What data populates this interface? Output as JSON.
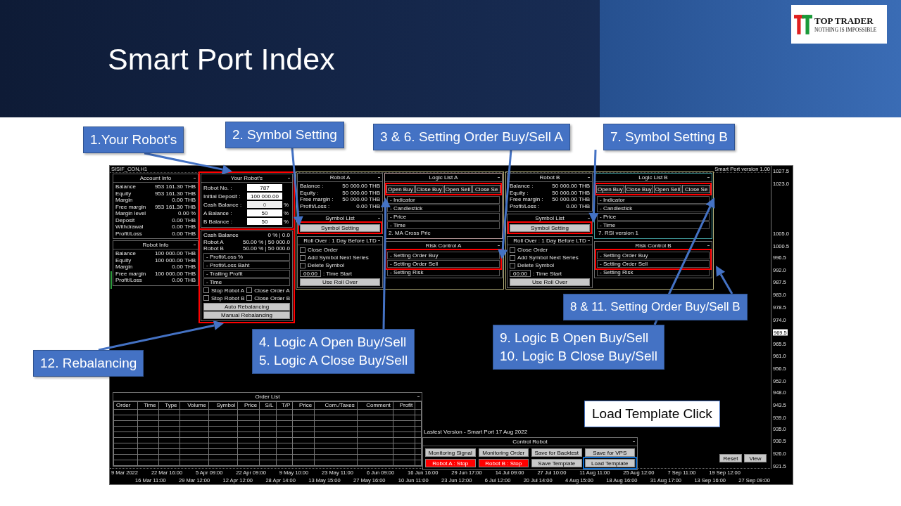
{
  "slide": {
    "title": "Smart Port Index",
    "logo": {
      "name": "TOP TRADER",
      "tagline": "NOTHING IS IMPOSSIBLE"
    }
  },
  "terminal": {
    "chart_title": "SISIF_CON,H1",
    "version": "Smart Port version 1.00",
    "account_info": {
      "title": "Account Info",
      "rows": [
        {
          "label": "Balance",
          "value": "953 161.30 THB"
        },
        {
          "label": "Equity",
          "value": "953 161.30 THB"
        },
        {
          "label": "Margin",
          "value": "0.00 THB"
        },
        {
          "label": "Free margin",
          "value": "953 161.30 THB"
        },
        {
          "label": "Margin level",
          "value": "0.00 %"
        },
        {
          "label": "Deposit",
          "value": "0.00 THB"
        },
        {
          "label": "Withdrawal",
          "value": "0.00 THB"
        },
        {
          "label": "Profit/Loss",
          "value": "0.00 THB"
        }
      ]
    },
    "robot_info": {
      "title": "Robot Info",
      "rows": [
        {
          "label": "Balance",
          "value": "100 000.00 THB"
        },
        {
          "label": "Equity",
          "value": "100 000.00 THB"
        },
        {
          "label": "Margin",
          "value": "0.00 THB"
        },
        {
          "label": "Free margin",
          "value": "100 000.00 THB"
        },
        {
          "label": "Profit/Loss",
          "value": "0.00 THB"
        }
      ]
    },
    "your_robots": {
      "title": "Your Robot's",
      "fields": [
        {
          "label": "Robot No. :",
          "value": "787",
          "disabled": false
        },
        {
          "label": "Initial Deposit :",
          "value": "100 000.00",
          "disabled": false
        },
        {
          "label": "Cash Balance :",
          "value": "0",
          "unit": "%",
          "disabled": true
        },
        {
          "label": "A Balance :",
          "value": "50",
          "unit": "%",
          "disabled": false
        },
        {
          "label": "B Balance :",
          "value": "50",
          "unit": "%",
          "disabled": false
        }
      ]
    },
    "rebalancing": {
      "rows": [
        {
          "label": "Cash Balance",
          "value": "0 % | 0.0"
        },
        {
          "label": "Robot A",
          "value": "50.00 % | 50 000.0"
        },
        {
          "label": "Robot B",
          "value": "50.00 % | 50 000.0"
        }
      ],
      "sections": [
        "- Profit/Loss %",
        "- Profit/Loss Baht",
        "- Trailing Profit",
        "- Time"
      ],
      "checkboxes": [
        {
          "label": "Stop Robot A",
          "checked": false
        },
        {
          "label": "Close Order A",
          "checked": false
        },
        {
          "label": "Stop Robot B",
          "checked": false
        },
        {
          "label": "Close Order B",
          "checked": false
        }
      ],
      "buttons": [
        "Auto Rebalancing",
        "Manual Rebalancing"
      ]
    },
    "robots": [
      {
        "title": "Robot A",
        "color": "#b89a9a",
        "rows": [
          {
            "label": "Balance :",
            "value": "50 000.00 THB"
          },
          {
            "label": "Equity :",
            "value": "50 000.00 THB"
          },
          {
            "label": "Free margin :",
            "value": "50 000.00 THB"
          },
          {
            "label": "Profit/Loss :",
            "value": "0.00 THB"
          }
        ],
        "symbol_list": {
          "title": "Symbol List",
          "button": "Symbol Setting"
        },
        "roll_over": {
          "title": "Roll Over : 1 Day Before LTD",
          "checkboxes": [
            {
              "label": "Close Order",
              "checked": false
            },
            {
              "label": "Add Symbol Next Series",
              "checked": false
            },
            {
              "label": "Delete Symbol",
              "checked": false
            }
          ],
          "time": "00:00",
          "time_label": ": Time Start",
          "button": "Use Roll Over"
        },
        "logic_list": {
          "title": "Logic List A",
          "tabs": [
            "Open Buy",
            "Close Buy",
            "Open Sell",
            "Close Se"
          ],
          "items": [
            "- Indicator",
            "- Candlestick",
            "- Price",
            "- Time"
          ],
          "selected_logic": "2. MA Cross Pric"
        },
        "risk_control": {
          "title": "Risk Control A",
          "items": [
            "- Setting Order Buy",
            "- Setting Order Sell",
            "- Setting Risk"
          ]
        }
      },
      {
        "title": "Robot B",
        "color": "#3f9a9a",
        "rows": [
          {
            "label": "Balance :",
            "value": "50 000.00 THB"
          },
          {
            "label": "Equity :",
            "value": "50 000.00 THB"
          },
          {
            "label": "Free margin :",
            "value": "50 000.00 THB"
          },
          {
            "label": "Profit/Loss :",
            "value": "0.00 THB"
          }
        ],
        "symbol_list": {
          "title": "Symbol List",
          "button": "Symbol Setting"
        },
        "roll_over": {
          "title": "Roll Over : 1 Day Before LTD",
          "checkboxes": [
            {
              "label": "Close Order",
              "checked": false
            },
            {
              "label": "Add Symbol Next Series",
              "checked": false
            },
            {
              "label": "Delete Symbol",
              "checked": false
            }
          ],
          "time": "00:00",
          "time_label": ": Time Start",
          "button": "Use Roll Over"
        },
        "logic_list": {
          "title": "Logic List B",
          "tabs": [
            "Open Buy",
            "Close Buy",
            "Open Sell",
            "Close Se"
          ],
          "items": [
            "- Indicator",
            "- Candlestick",
            "- Price",
            "- Time"
          ],
          "selected_logic": "7. RSI version 1"
        },
        "risk_control": {
          "title": "Risk Control B",
          "items": [
            "- Setting Order Buy",
            "- Setting Order Sell",
            "- Setting Risk"
          ]
        }
      }
    ],
    "order_list": {
      "title": "Order List",
      "columns": [
        "Order",
        "Time",
        "Type",
        "Volume",
        "Symbol",
        "Price",
        "S/L",
        "T/P",
        "Price",
        "Com./Taxes",
        "Comment",
        "Profit"
      ]
    },
    "caption": "Lastest Version - Smart Port 17 Aug 2022",
    "control_robot": {
      "title": "Control Robot",
      "buttons": [
        {
          "label": "Monitoring Signal",
          "kind": "normal"
        },
        {
          "label": "Monitoring Order",
          "kind": "normal"
        },
        {
          "label": "Save for Backtest",
          "kind": "normal"
        },
        {
          "label": "Save for VPS",
          "kind": "normal"
        },
        {
          "label": "Robot A : Stop",
          "kind": "stop"
        },
        {
          "label": "Robot B : Stop",
          "kind": "stop"
        },
        {
          "label": "Save Template",
          "kind": "normal"
        },
        {
          "label": "Load Template",
          "kind": "normal"
        }
      ]
    },
    "chart_buttons": [
      "Reset",
      "View"
    ],
    "price_axis": [
      {
        "label": "1027.5",
        "current": false
      },
      {
        "label": "1023.0",
        "current": false
      },
      {
        "label": "1005.0",
        "current": false
      },
      {
        "label": "1000.5",
        "current": false
      },
      {
        "label": "996.5",
        "current": false
      },
      {
        "label": "992.0",
        "current": false
      },
      {
        "label": "987.5",
        "current": false
      },
      {
        "label": "983.0",
        "current": false
      },
      {
        "label": "978.5",
        "current": false
      },
      {
        "label": "974.0",
        "current": false
      },
      {
        "label": "969.5",
        "current": true
      },
      {
        "label": "965.5",
        "current": false
      },
      {
        "label": "961.0",
        "current": false
      },
      {
        "label": "956.5",
        "current": false
      },
      {
        "label": "952.0",
        "current": false
      },
      {
        "label": "948.0",
        "current": false
      },
      {
        "label": "943.5",
        "current": false
      },
      {
        "label": "939.0",
        "current": false
      },
      {
        "label": "935.0",
        "current": false
      },
      {
        "label": "930.5",
        "current": false
      },
      {
        "label": "926.0",
        "current": false
      },
      {
        "label": "921.5",
        "current": false
      }
    ],
    "time_axis": [
      "9 Mar 2022",
      "16 Mar 11:00",
      "22 Mar 16:00",
      "29 Mar 12:00",
      "5 Apr 09:00",
      "12 Apr 12:00",
      "22 Apr 09:00",
      "28 Apr 14:00",
      "9 May 10:00",
      "13 May 15:00",
      "23 May 11:00",
      "27 May 16:00",
      "6 Jun 09:00",
      "10 Jun 11:00",
      "16 Jun 16:00",
      "23 Jun 12:00",
      "29 Jun 17:00",
      "6 Jul 12:00",
      "14 Jul 09:00",
      "20 Jul 14:00",
      "27 Jul 10:00",
      "4 Aug 15:00",
      "11 Aug 11:00",
      "18 Aug 16:00",
      "25 Aug 12:00",
      "31 Aug 17:00",
      "7 Sep 11:00",
      "13 Sep 16:00",
      "19 Sep 12:00",
      "27 Sep 09:00"
    ]
  },
  "callouts": [
    {
      "kind": "callout",
      "lines": [
        "1.Your Robot's"
      ]
    },
    {
      "kind": "callout",
      "lines": [
        "2. Symbol Setting"
      ]
    },
    {
      "kind": "callout",
      "lines": [
        "3 & 6. Setting Order Buy/Sell A"
      ]
    },
    {
      "kind": "callout",
      "lines": [
        "7. Symbol Setting B"
      ]
    },
    {
      "kind": "callout",
      "lines": [
        "8 & 11. Setting Order Buy/Sell B"
      ]
    },
    {
      "kind": "callout",
      "lines": [
        "4. Logic A Open Buy/Sell",
        "5. Logic A Close Buy/Sell"
      ]
    },
    {
      "kind": "callout",
      "lines": [
        "9. Logic B Open Buy/Sell",
        "10. Logic B Close Buy/Sell"
      ]
    },
    {
      "kind": "callout",
      "lines": [
        "12. Rebalancing"
      ]
    },
    {
      "kind": "note",
      "lines": [
        "Load Template Click"
      ]
    }
  ]
}
